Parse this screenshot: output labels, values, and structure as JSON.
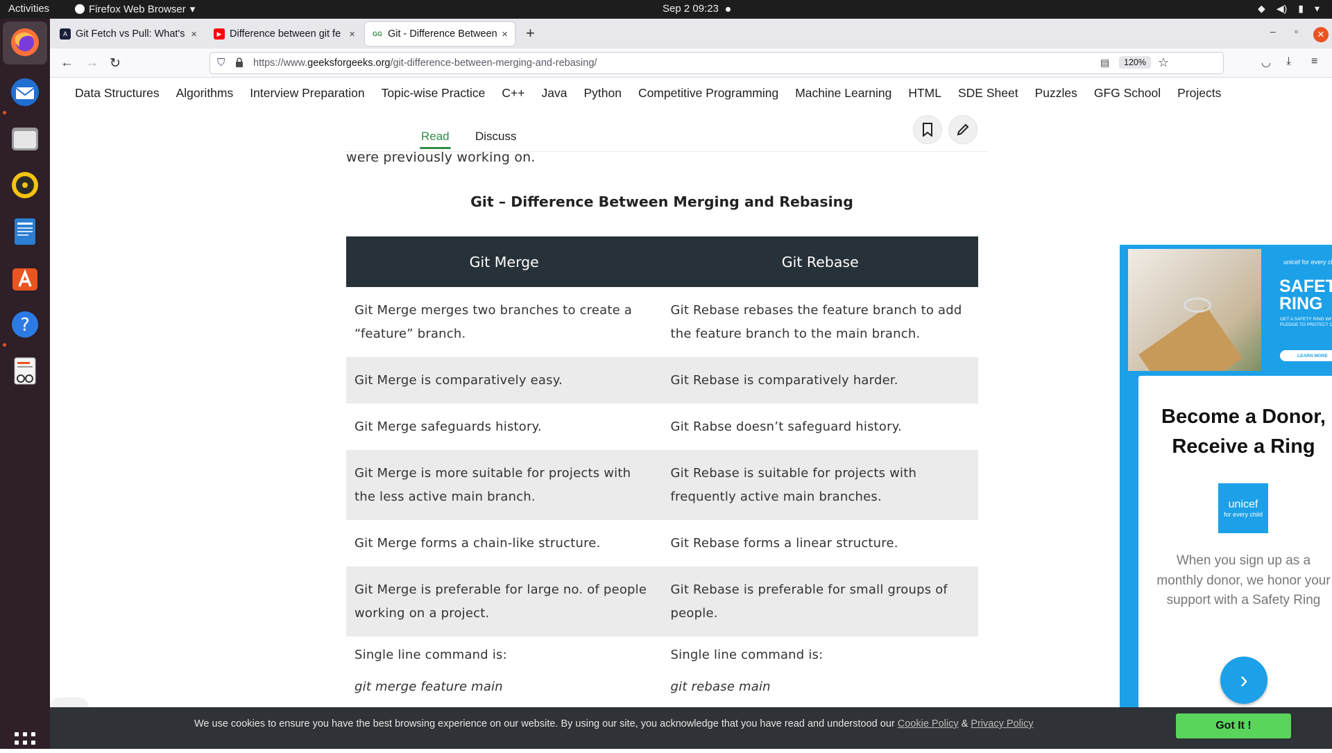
{
  "system_bar": {
    "activities": "Activities",
    "app_name": "Firefox Web Browser",
    "clock": "Sep 2  09:23"
  },
  "dock": {
    "items": [
      "firefox-icon",
      "thunderbird-icon",
      "files-icon",
      "rhythmbox-icon",
      "libreoffice-writer-icon",
      "software-center-icon",
      "help-icon",
      "document-viewer-icon"
    ],
    "show_apps": "show-applications-icon"
  },
  "browser": {
    "tabs": [
      {
        "title": "Git Fetch vs Pull: What's t",
        "active": false,
        "favicon_color": "#1b1f3b"
      },
      {
        "title": "Difference between git fe",
        "active": false,
        "favicon_color": "#ff0000"
      },
      {
        "title": "Git - Difference Between",
        "active": true,
        "favicon_color": "#2f8d46"
      }
    ],
    "url_prefix": "https://www.",
    "url_domain": "geeksforgeeks.org",
    "url_path": "/git-difference-between-merging-and-rebasing/",
    "zoom": "120%"
  },
  "site_nav": [
    "Data Structures",
    "Algorithms",
    "Interview Preparation",
    "Topic-wise Practice",
    "C++",
    "Java",
    "Python",
    "Competitive Programming",
    "Machine Learning",
    "HTML",
    "SDE Sheet",
    "Puzzles",
    "GFG School",
    "Projects"
  ],
  "article": {
    "tabs": {
      "read": "Read",
      "discuss": "Discuss"
    },
    "prev_text": "were previously working on.",
    "table_title": "Git – Difference Between Merging and Rebasing",
    "table": {
      "headers": [
        "Git Merge",
        "Git Rebase"
      ],
      "rows": [
        [
          "Git Merge merges two branches to create a “feature” branch.",
          "Git Rebase rebases the feature branch to add the feature branch to the main branch."
        ],
        [
          "Git Merge is comparatively easy.",
          "Git Rebase is comparatively harder."
        ],
        [
          "Git Merge safeguards history.",
          "Git Rabse doesn’t safeguard history."
        ],
        [
          "Git Merge is more suitable for projects with the less active main branch.",
          "Git Rebase is suitable for projects with frequently active main branches."
        ],
        [
          "Git Merge forms a chain-like structure.",
          "Git Rebase forms a linear structure."
        ],
        [
          "Git Merge is preferable for large no. of people working on a project.",
          "Git Rebase is preferable for small groups of people."
        ]
      ],
      "last_row": {
        "left_label": "Single line command is:",
        "left_cmd": "git merge feature main",
        "right_label": "Single line command is:",
        "right_cmd": "git rebase main"
      }
    }
  },
  "ad": {
    "small_brand": "unicef for every child",
    "headline": "SAFETY RING",
    "subline": "GET A SAFETY RING WHEN YOU PLEDGE TO PROTECT CHILDREN",
    "learn_more": "LEARN MORE",
    "card_title": "Become a Donor, Receive a Ring",
    "logo_line1": "unicef",
    "logo_line2": "for every child",
    "card_text": "When you sign up as a monthly donor, we honor your support with a Safety Ring",
    "accent": "#1ca0e8"
  },
  "cookie": {
    "message": "We use cookies to ensure you have the best browsing experience on our website. By using our site, you acknowledge that you have read and understood our ",
    "cookie_policy": "Cookie Policy",
    "amp": " & ",
    "privacy_policy": "Privacy Policy",
    "button": "Got It !"
  }
}
